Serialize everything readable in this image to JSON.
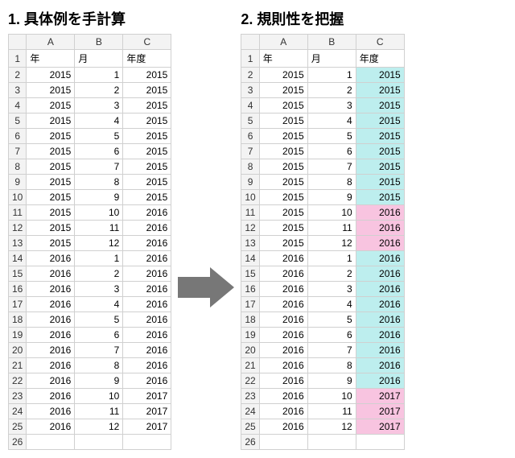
{
  "panels": {
    "left": {
      "title": "1.  具体例を手計算"
    },
    "right": {
      "title": "2.  規則性を把握"
    }
  },
  "columns": [
    "A",
    "B",
    "C"
  ],
  "headers": {
    "year": "年",
    "month": "月",
    "fiscal": "年度"
  },
  "row_numbers": [
    "1",
    "2",
    "3",
    "4",
    "5",
    "6",
    "7",
    "8",
    "9",
    "10",
    "11",
    "12",
    "13",
    "14",
    "15",
    "16",
    "17",
    "18",
    "19",
    "20",
    "21",
    "22",
    "23",
    "24",
    "25",
    "26"
  ],
  "chart_data": {
    "type": "table",
    "columns": [
      "年",
      "月",
      "年度"
    ],
    "rows": [
      {
        "year": 2015,
        "month": 1,
        "fiscal": 2015
      },
      {
        "year": 2015,
        "month": 2,
        "fiscal": 2015
      },
      {
        "year": 2015,
        "month": 3,
        "fiscal": 2015
      },
      {
        "year": 2015,
        "month": 4,
        "fiscal": 2015
      },
      {
        "year": 2015,
        "month": 5,
        "fiscal": 2015
      },
      {
        "year": 2015,
        "month": 6,
        "fiscal": 2015
      },
      {
        "year": 2015,
        "month": 7,
        "fiscal": 2015
      },
      {
        "year": 2015,
        "month": 8,
        "fiscal": 2015
      },
      {
        "year": 2015,
        "month": 9,
        "fiscal": 2015
      },
      {
        "year": 2015,
        "month": 10,
        "fiscal": 2016
      },
      {
        "year": 2015,
        "month": 11,
        "fiscal": 2016
      },
      {
        "year": 2015,
        "month": 12,
        "fiscal": 2016
      },
      {
        "year": 2016,
        "month": 1,
        "fiscal": 2016
      },
      {
        "year": 2016,
        "month": 2,
        "fiscal": 2016
      },
      {
        "year": 2016,
        "month": 3,
        "fiscal": 2016
      },
      {
        "year": 2016,
        "month": 4,
        "fiscal": 2016
      },
      {
        "year": 2016,
        "month": 5,
        "fiscal": 2016
      },
      {
        "year": 2016,
        "month": 6,
        "fiscal": 2016
      },
      {
        "year": 2016,
        "month": 7,
        "fiscal": 2016
      },
      {
        "year": 2016,
        "month": 8,
        "fiscal": 2016
      },
      {
        "year": 2016,
        "month": 9,
        "fiscal": 2016
      },
      {
        "year": 2016,
        "month": 10,
        "fiscal": 2017
      },
      {
        "year": 2016,
        "month": 11,
        "fiscal": 2017
      },
      {
        "year": 2016,
        "month": 12,
        "fiscal": 2017
      }
    ],
    "highlight": {
      "cyan_rows": [
        0,
        1,
        2,
        3,
        4,
        5,
        6,
        7,
        8,
        12,
        13,
        14,
        15,
        16,
        17,
        18,
        19,
        20
      ],
      "pink_rows": [
        9,
        10,
        11,
        21,
        22,
        23
      ]
    }
  },
  "left_truncated_last": {
    "year": "2016",
    "month": "12",
    "fiscal": "2017"
  }
}
